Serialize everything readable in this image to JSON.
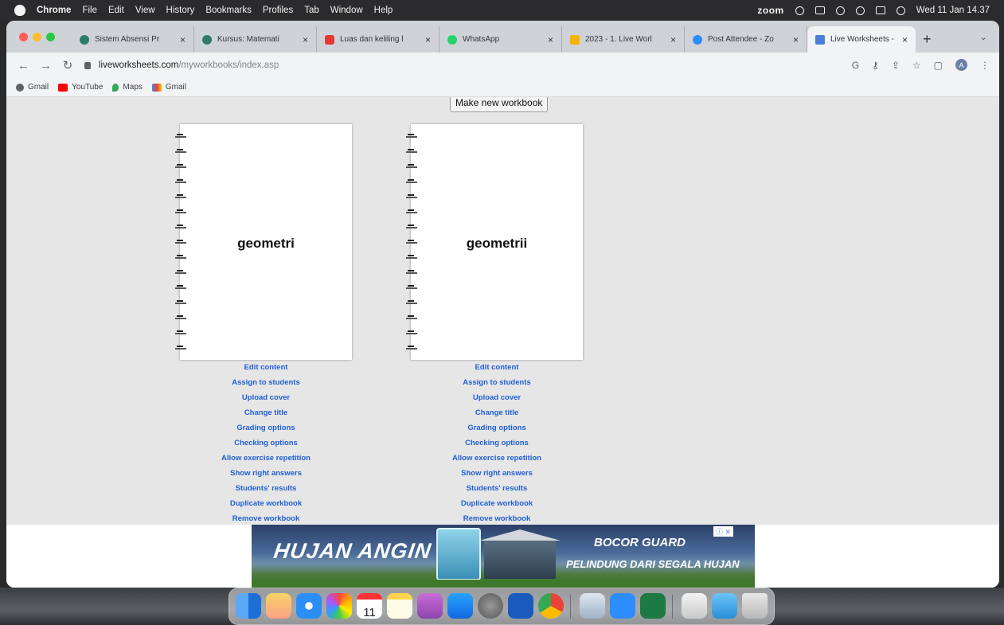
{
  "menubar": {
    "app": "Chrome",
    "items": [
      "File",
      "Edit",
      "View",
      "History",
      "Bookmarks",
      "Profiles",
      "Tab",
      "Window",
      "Help"
    ],
    "zoom": "zoom",
    "datetime": "Wed 11 Jan 14.37"
  },
  "tabs": [
    {
      "title": "Sistem Absensi Pr",
      "favicon_color": "#2e7d6b"
    },
    {
      "title": "Kursus: Matemati",
      "favicon_color": "#2e7d6b"
    },
    {
      "title": "Luas dan keliling l",
      "favicon_color": "#e53935"
    },
    {
      "title": "WhatsApp",
      "favicon_color": "#25d366"
    },
    {
      "title": "2023 - 1. Live Worl",
      "favicon_color": "#f4b400"
    },
    {
      "title": "Post Attendee - Zo",
      "favicon_color": "#2d8cff"
    },
    {
      "title": "Live Worksheets - ",
      "favicon_color": "#4a7fd6"
    }
  ],
  "address": {
    "host": "liveworksheets.com",
    "path": "/myworkbooks/index.asp"
  },
  "bookmarks": [
    {
      "label": "Gmail",
      "icon": "globe-icon"
    },
    {
      "label": "YouTube",
      "icon": "youtube-icon"
    },
    {
      "label": "Maps",
      "icon": "maps-icon"
    },
    {
      "label": "Gmail",
      "icon": "gmail-icon"
    }
  ],
  "page": {
    "make_new_workbook": "Make new workbook",
    "workbooks": [
      {
        "title": "geometri"
      },
      {
        "title": "geometrii"
      }
    ],
    "actions": [
      "Edit content",
      "Assign to students",
      "Upload cover",
      "Change title",
      "Grading options",
      "Checking options",
      "Allow exercise repetition",
      "Show right answers",
      "Students' results",
      "Duplicate workbook",
      "Remove workbook"
    ]
  },
  "ad": {
    "left_text": "HUJAN ANGIN",
    "brand": "BOCOR GUARD",
    "tagline": "PELINDUNG DARI SEGALA HUJAN"
  },
  "dock": {
    "calendar_day": "11"
  },
  "colors": {
    "link": "#1f5fd6",
    "page_bg": "#e6e6e6"
  }
}
